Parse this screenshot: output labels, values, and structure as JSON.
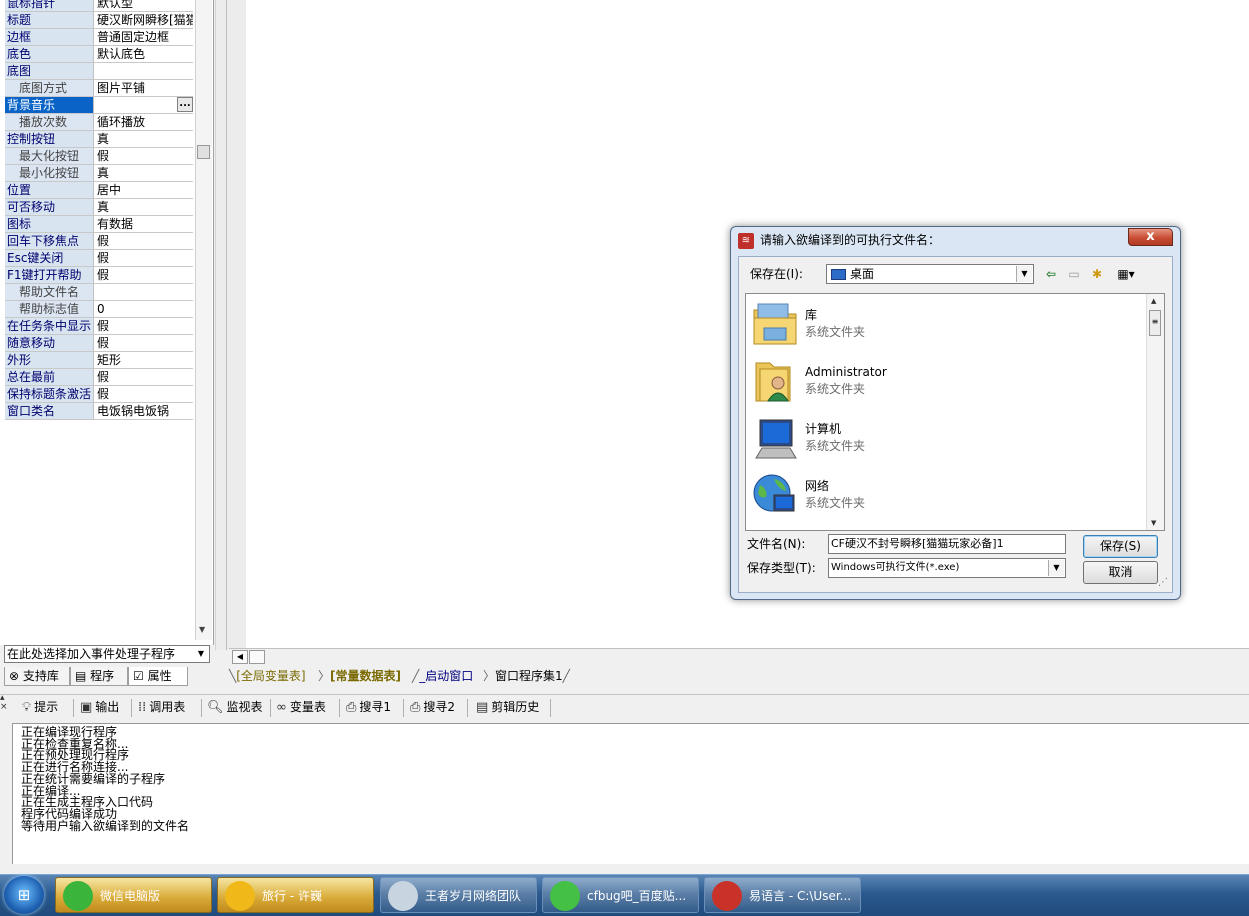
{
  "properties": [
    {
      "name": "鼠标指针",
      "value": "默认型",
      "sub": false
    },
    {
      "name": "标题",
      "value": "硬汉断网瞬移[猫猫",
      "sub": false
    },
    {
      "name": "边框",
      "value": "普通固定边框",
      "sub": false
    },
    {
      "name": "底色",
      "value": "默认底色",
      "sub": false
    },
    {
      "name": "底图",
      "value": "",
      "sub": false
    },
    {
      "name": "底图方式",
      "value": "图片平铺",
      "sub": true
    },
    {
      "name": "背景音乐",
      "value": "",
      "sub": false,
      "selected": true
    },
    {
      "name": "播放次数",
      "value": "循环播放",
      "sub": true
    },
    {
      "name": "控制按钮",
      "value": "真",
      "sub": false
    },
    {
      "name": "最大化按钮",
      "value": "假",
      "sub": true
    },
    {
      "name": "最小化按钮",
      "value": "真",
      "sub": true
    },
    {
      "name": "位置",
      "value": "居中",
      "sub": false
    },
    {
      "name": "可否移动",
      "value": "真",
      "sub": false
    },
    {
      "name": "图标",
      "value": "有数据",
      "sub": false
    },
    {
      "name": "回车下移焦点",
      "value": "假",
      "sub": false
    },
    {
      "name": "Esc键关闭",
      "value": "假",
      "sub": false
    },
    {
      "name": "F1键打开帮助",
      "value": "假",
      "sub": false
    },
    {
      "name": "帮助文件名",
      "value": "",
      "sub": true
    },
    {
      "name": "帮助标志值",
      "value": "0",
      "sub": true
    },
    {
      "name": "在任务条中显示",
      "value": "假",
      "sub": false
    },
    {
      "name": "随意移动",
      "value": "假",
      "sub": false
    },
    {
      "name": "外形",
      "value": "矩形",
      "sub": false
    },
    {
      "name": "总在最前",
      "value": "假",
      "sub": false
    },
    {
      "name": "保持标题条激活",
      "value": "假",
      "sub": false
    },
    {
      "name": "窗口类名",
      "value": "电饭锅电饭锅",
      "sub": false
    }
  ],
  "event_select": {
    "value": "在此处选择加入事件处理子程序"
  },
  "left_tabs": [
    "支持库",
    "程序",
    "属性"
  ],
  "editor_tabs": [
    "[全局变量表]",
    "[常量数据表]",
    "_启动窗口",
    "窗口程序集1"
  ],
  "bottom_tabs": [
    "提示",
    "输出",
    "调用表",
    "监视表",
    "变量表",
    "搜寻1",
    "搜寻2",
    "剪辑历史"
  ],
  "output_lines": [
    "正在编译现行程序",
    "正在检查重复名称...",
    "正在预处理现行程序",
    "正在进行名称连接...",
    "正在统计需要编译的子程序",
    "正在编译...",
    "正在生成主程序入口代码",
    "程序代码编译成功",
    "等待用户输入欲编译到的文件名"
  ],
  "dialog": {
    "title": "请输入欲编译到的可执行文件名：",
    "close": "x",
    "save_in_label": "保存在(I):",
    "save_in_value": "桌面",
    "items": [
      {
        "name": "库",
        "desc": "系统文件夹"
      },
      {
        "name": "Administrator",
        "desc": "系统文件夹"
      },
      {
        "name": "计算机",
        "desc": "系统文件夹"
      },
      {
        "name": "网络",
        "desc": "系统文件夹"
      }
    ],
    "filename_label": "文件名(N):",
    "filename_value": "CF硬汉不封号瞬移[猫猫玩家必备]1",
    "filetype_label": "保存类型(T):",
    "filetype_value": "Windows可执行文件(*.exe)",
    "save_button": "保存(S)",
    "cancel_button": "取消"
  },
  "taskbar": [
    {
      "label": "微信电脑版",
      "color": "#3bb43b"
    },
    {
      "label": "旅行 - 许巍",
      "color": "#f0b818"
    },
    {
      "label": "王者岁月网络团队",
      "color": "#c8d4e0"
    },
    {
      "label": "cfbug吧_百度贴...",
      "color": "#44c044"
    },
    {
      "label": "易语言 - C:\\User...",
      "color": "#c83228"
    }
  ],
  "colors": {
    "selected_row": "#0a64c8",
    "accent_tab": "#7a6a00"
  }
}
